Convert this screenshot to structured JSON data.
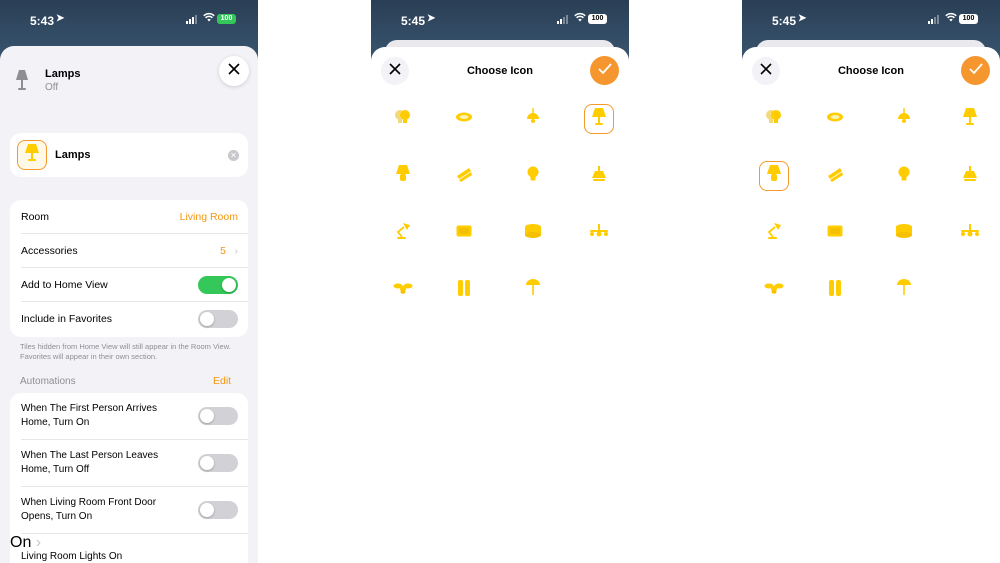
{
  "screen1": {
    "status": {
      "time": "5:43",
      "battery": "100"
    },
    "header": {
      "title": "Lamps",
      "subtitle": "Off"
    },
    "name_field": {
      "value": "Lamps"
    },
    "rows": [
      {
        "label": "Room",
        "value": "Living Room"
      },
      {
        "label": "Accessories",
        "value": "5"
      },
      {
        "label": "Add to Home View",
        "toggle": true
      },
      {
        "label": "Include in Favorites",
        "toggle": false
      }
    ],
    "footnote": "Tiles hidden from Home View will still appear in the Room View. Favorites will appear in their own section.",
    "automations": {
      "title": "Automations",
      "edit": "Edit",
      "items": [
        {
          "label": "When The First Person Arrives Home, Turn On",
          "toggle": false
        },
        {
          "label": "When The Last Person Leaves Home, Turn Off",
          "toggle": false
        },
        {
          "label": "When Living Room Front Door Opens, Turn On",
          "toggle": false
        },
        {
          "label": "Living Room Lights On",
          "value": "On"
        }
      ]
    }
  },
  "screen2": {
    "status": {
      "time": "5:45",
      "battery": "100"
    },
    "title": "Choose Icon",
    "selected_index": 3
  },
  "screen3": {
    "status": {
      "time": "5:45",
      "battery": "100"
    },
    "title": "Choose Icon",
    "selected_index": 4
  },
  "icons": [
    "bulbs-icon",
    "ceiling-light-icon",
    "pendant-light-icon",
    "table-lamp-icon",
    "lamp-icon",
    "light-strip-icon",
    "bulb-icon",
    "desk-lamp-cone-icon",
    "desk-lamp-icon",
    "panel-light-icon",
    "puck-light-icon",
    "chandelier-icon",
    "ceiling-fan-icon",
    "wall-light-icon",
    "floor-lamp-icon"
  ],
  "colors": {
    "accent": "#f2960f",
    "icon_yellow": "#ffcc00",
    "toggle_on": "#34c759"
  }
}
